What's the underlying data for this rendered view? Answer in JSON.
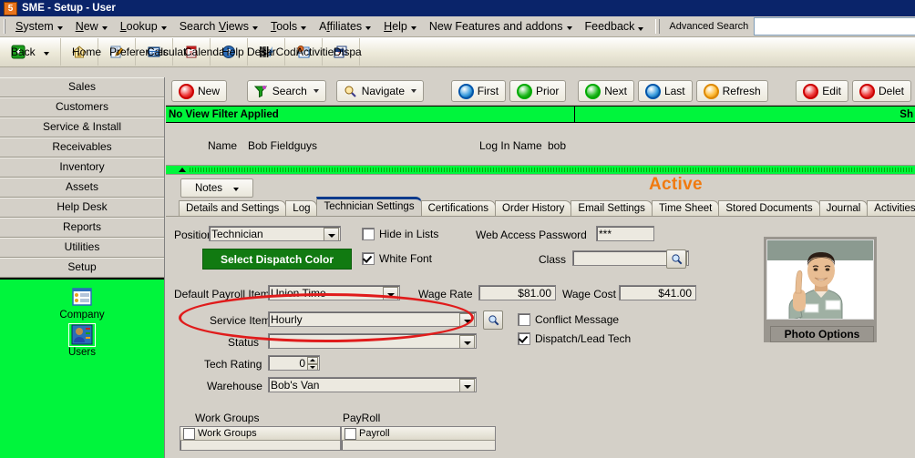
{
  "window": {
    "title": "SME - Setup - User",
    "logo_text": "5"
  },
  "menubar": {
    "items": [
      {
        "label": "System",
        "accel": "S",
        "has_caret": true
      },
      {
        "label": "New",
        "accel": "N",
        "has_caret": true
      },
      {
        "label": "Lookup",
        "accel": "L",
        "has_caret": true
      },
      {
        "label": "Search Views",
        "accel": "V",
        "has_caret": true
      },
      {
        "label": "Tools",
        "accel": "T",
        "has_caret": true
      },
      {
        "label": "Affiliates",
        "accel": "f",
        "has_caret": true
      },
      {
        "label": "Help",
        "accel": "H",
        "has_caret": true
      },
      {
        "label": "New Features and addons",
        "accel": "",
        "has_caret": true
      },
      {
        "label": "Feedback",
        "accel": "",
        "has_caret": true
      }
    ],
    "advanced_search_label": "Advanced Search",
    "advanced_search_value": "",
    "advanced_search_placeholder": ""
  },
  "icon_toolbar": {
    "buttons": [
      {
        "label": "Back",
        "icon": "back-arrow-icon",
        "has_caret": true
      },
      {
        "label": "Home",
        "icon": "home-icon",
        "has_caret": false
      },
      {
        "label": "Preferences",
        "icon": "preferences-icon",
        "has_caret": false
      },
      {
        "label": "Calculator",
        "icon": "calculator-icon",
        "has_caret": false
      },
      {
        "label": "Calendar",
        "icon": "calendar-icon",
        "has_caret": false
      },
      {
        "label": "Help Desk",
        "icon": "help-desk-icon",
        "has_caret": false
      },
      {
        "label": "BarCoding",
        "icon": "barcode-icon",
        "has_caret": false
      },
      {
        "label": "Activities",
        "icon": "activities-icon",
        "has_caret": false
      },
      {
        "label": "Dispa",
        "icon": "dispatch-icon",
        "has_caret": false
      }
    ]
  },
  "sidebar": {
    "modules": [
      {
        "label": "Sales"
      },
      {
        "label": "Customers"
      },
      {
        "label": "Service & Install"
      },
      {
        "label": "Receivables"
      },
      {
        "label": "Inventory"
      },
      {
        "label": "Assets"
      },
      {
        "label": "Help Desk"
      },
      {
        "label": "Reports"
      },
      {
        "label": "Utilities"
      },
      {
        "label": "Setup"
      }
    ],
    "shortcuts": [
      {
        "label": "Company",
        "icon": "company-icon",
        "selected": false
      },
      {
        "label": "Users",
        "icon": "users-icon",
        "selected": true
      }
    ],
    "background_color": "#00f53c"
  },
  "record_toolbar": {
    "new_label": "New",
    "search_label": "Search",
    "navigate_label": "Navigate",
    "first_label": "First",
    "prior_label": "Prior",
    "next_label": "Next",
    "last_label": "Last",
    "refresh_label": "Refresh",
    "edit_label": "Edit",
    "delete_label": "Delet"
  },
  "filter_bar": {
    "left_text": "No View Filter Applied",
    "right_text": "Sh",
    "color": "#00f53c"
  },
  "header_fields": {
    "name_label": "Name",
    "name_value": "Bob Fieldguys",
    "login_label": "Log In Name",
    "login_value": "bob"
  },
  "notes": {
    "button_label": "Notes"
  },
  "status": {
    "text": "Active",
    "color": "#f07a10"
  },
  "tabs": [
    {
      "label": "Details and Settings",
      "active": false
    },
    {
      "label": "Log",
      "active": false
    },
    {
      "label": "Technician Settings",
      "active": true
    },
    {
      "label": "Certifications",
      "active": false
    },
    {
      "label": "Order History",
      "active": false
    },
    {
      "label": "Email Settings",
      "active": false
    },
    {
      "label": "Time Sheet",
      "active": false
    },
    {
      "label": "Stored Documents",
      "active": false
    },
    {
      "label": "Journal",
      "active": false
    },
    {
      "label": "Activities",
      "active": false
    }
  ],
  "form": {
    "position_label": "Position",
    "position_value": "Technician",
    "dispatch_color_label": "Select Dispatch Color",
    "hide_in_lists_label": "Hide in Lists",
    "hide_in_lists_checked": false,
    "white_font_label": "White Font",
    "white_font_checked": true,
    "web_access_password_label": "Web Access Password",
    "web_access_password_value": "***",
    "class_label": "Class",
    "class_value": "",
    "default_payroll_item_label": "Default Payroll Item",
    "default_payroll_item_value": "Union Time",
    "wage_rate_label": "Wage Rate",
    "wage_rate_value": "$81.00",
    "wage_cost_label": "Wage Cost",
    "wage_cost_value": "$41.00",
    "service_item_label": "Service Item",
    "service_item_value": "Hourly",
    "status_label": "Status",
    "status_value": "",
    "tech_rating_label": "Tech Rating",
    "tech_rating_value": "0",
    "warehouse_label": "Warehouse",
    "warehouse_value": "Bob's Van",
    "conflict_message_label": "Conflict Message",
    "conflict_message_checked": false,
    "dispatch_lead_tech_label": "Dispatch/Lead Tech",
    "dispatch_lead_tech_checked": true,
    "work_groups_caption": "Work Groups",
    "work_groups_header": "Work Groups",
    "payroll_caption": "PayRoll",
    "payroll_header": "Payroll"
  },
  "photo": {
    "options_label": "Photo Options"
  },
  "annotation": {
    "shape": "ellipse",
    "color": "#e01b1b",
    "target": "default-payroll-item-field"
  }
}
